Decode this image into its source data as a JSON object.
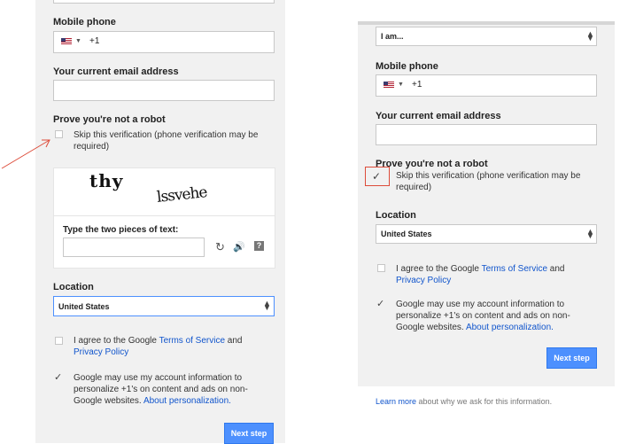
{
  "left": {
    "mobile_label": "Mobile phone",
    "phone_prefix": "+1",
    "email_label": "Your current email address",
    "robot_label": "Prove you're not a robot",
    "skip_text": "Skip this verification (phone verification may be required)",
    "captcha_word1": "thy",
    "captcha_word2": "lssvehe",
    "captcha_prompt": "Type the two pieces of text:",
    "location_label": "Location",
    "location_value": "United States",
    "agree_prefix": "I agree to the Google ",
    "terms_link": "Terms of Service",
    "agree_and": " and",
    "privacy_link": "Privacy Policy",
    "personalize_text": "Google may use my account information to personalize +1's on content and ads on non-Google websites.",
    "personalize_link": "About personalization.",
    "next_label": "Next step"
  },
  "right": {
    "iam_value": "I am...",
    "mobile_label": "Mobile phone",
    "phone_prefix": "+1",
    "email_label": "Your current email address",
    "robot_label": "Prove you're not a robot",
    "skip_text": "Skip this verification (phone verification may be required)",
    "location_label": "Location",
    "location_value": "United States",
    "agree_prefix": "I agree to the Google ",
    "terms_link": "Terms of Service",
    "agree_and": " and",
    "privacy_link": "Privacy Policy",
    "personalize_text": "Google may use my account information to personalize +1's on content and ads on non-Google websites.",
    "personalize_link": "About personalization.",
    "next_label": "Next step",
    "footer_link": "Learn more",
    "footer_text": " about why we ask for this information."
  },
  "colors": {
    "accent": "#4d90fe",
    "link": "#1155cc",
    "annotation": "#dd4b39"
  },
  "icons": [
    "us-flag-icon",
    "chevron-down-icon",
    "select-arrows-icon",
    "checkmark-icon",
    "refresh-icon",
    "audio-icon",
    "help-icon",
    "annotation-arrow"
  ]
}
